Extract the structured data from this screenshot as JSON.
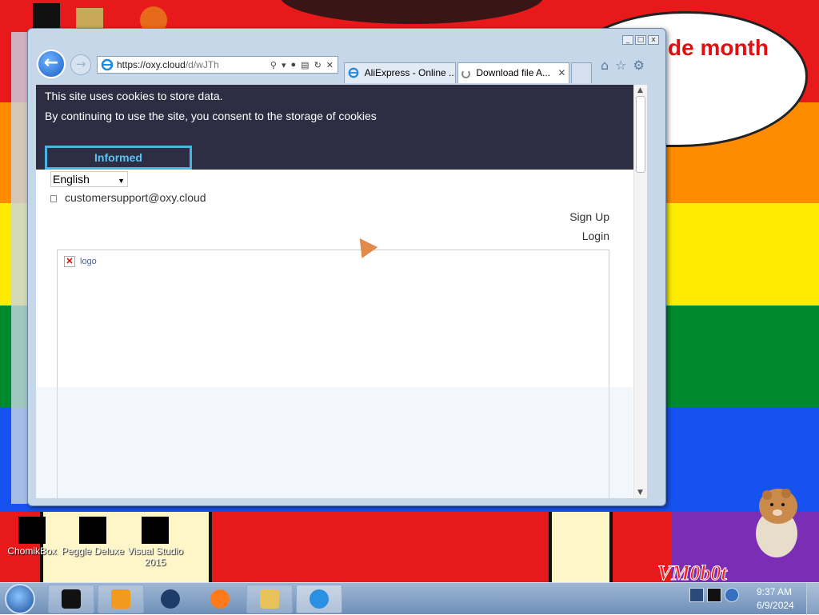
{
  "desktop": {
    "bubble_text": "de month",
    "icons": [
      {
        "label": "ChomikBox"
      },
      {
        "label": "Peggle Deluxe"
      },
      {
        "label": "Visual Studio 2015"
      }
    ],
    "vm_label": "VM0b0t"
  },
  "browser": {
    "address_bar": {
      "url_main": "https://oxy.cloud",
      "url_path": "/d/wJTh"
    },
    "tabs": [
      {
        "label": "AliExpress - Online ..."
      },
      {
        "label": "Download file A..."
      }
    ],
    "window_controls": {
      "minimize": "_",
      "maximize": "□",
      "close": "x"
    }
  },
  "page": {
    "cookie_banner": {
      "line1": "This site uses cookies to store data.",
      "line2": "By continuing to use the site, you consent to the storage of cookies",
      "button_label": "Informed"
    },
    "language_select": {
      "selected": "English"
    },
    "support_email": "customersupport@oxy.cloud",
    "sign_up_label": "Sign Up",
    "login_label": "Login",
    "logo_alt": "logo"
  },
  "taskbar": {
    "clock_time": "9:37 AM",
    "clock_date": "6/9/2024"
  },
  "colors": {
    "cookie_banner_bg": "#2d2d44",
    "informed_accent": "#46b4e8",
    "rainbow": [
      "#e8191b",
      "#ff8c00",
      "#ffeb00",
      "#008a2e",
      "#1652f0",
      "#7a2db5"
    ]
  }
}
